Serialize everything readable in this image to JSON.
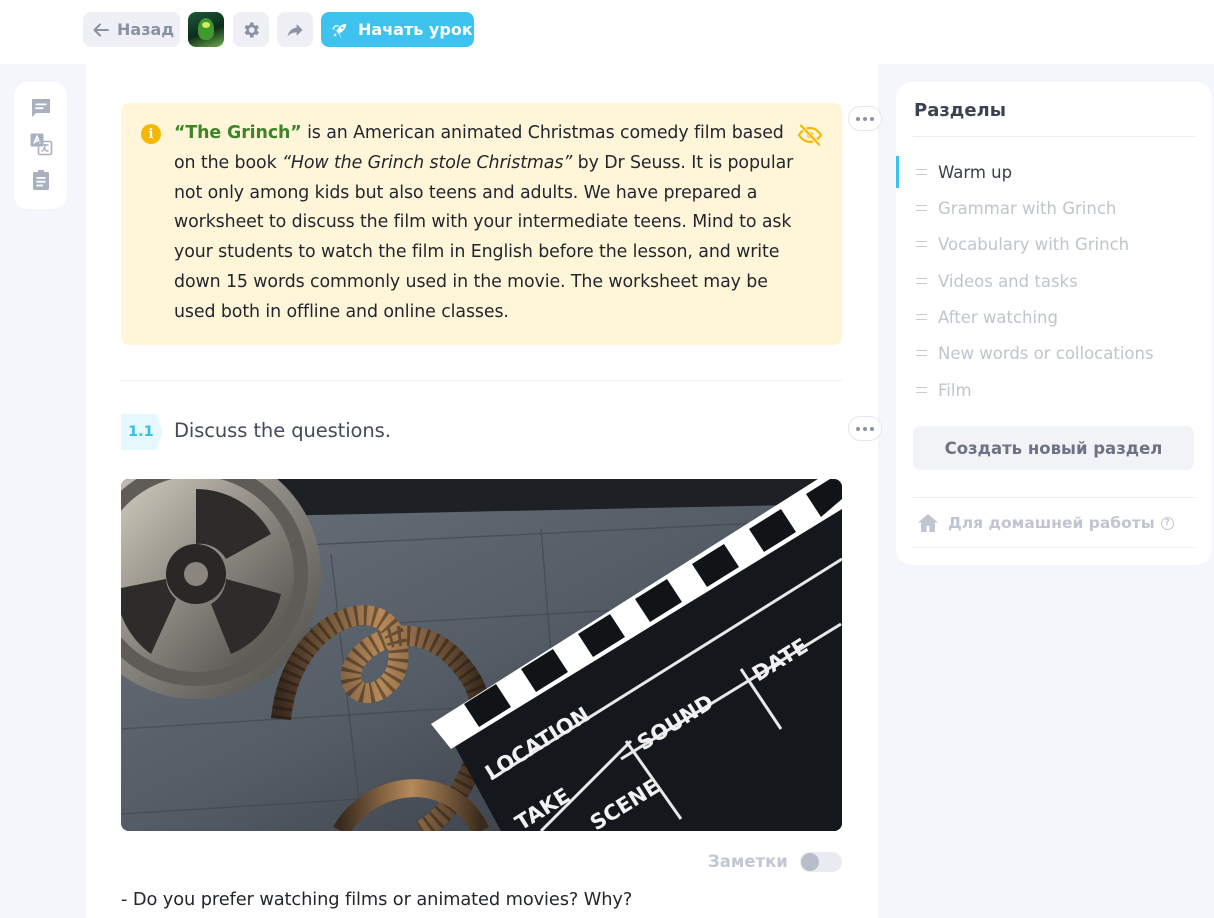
{
  "toolbar": {
    "back_label": "Назад",
    "start_label": "Начать урок",
    "accent_color": "#3ec3ee"
  },
  "tools": [
    "chat-icon",
    "translate-icon",
    "clipboard-icon"
  ],
  "info": {
    "highlight": "“The Grinch”",
    "text_1": " is an American animated Christmas comedy film based on the book ",
    "book_title": "“How the Grinch stole Christmas”",
    "text_2": " by Dr Seuss. It is popular not only among kids but also teens and adults. We have prepared a worksheet to discuss the film with your intermediate teens. Mind to ask your students to watch the film in English before the lesson, and write down 15 words commonly used in the movie. The worksheet may be used both in offline and online classes."
  },
  "exercise": {
    "number": "1.1",
    "title": "Discuss the questions."
  },
  "clapperboard": {
    "location": "LOCATION",
    "sound": "SOUND",
    "date": "DATE",
    "take": "TAKE",
    "scene": "SCENE"
  },
  "notes": {
    "label": "Заметки",
    "enabled": false
  },
  "question_1": "- Do you prefer watching films or animated movies? Why?",
  "sections": {
    "title": "Разделы",
    "items": [
      {
        "label": "Warm up",
        "active": true
      },
      {
        "label": "Grammar with Grinch",
        "active": false
      },
      {
        "label": "Vocabulary with Grinch",
        "active": false
      },
      {
        "label": "Videos and tasks",
        "active": false
      },
      {
        "label": "After watching",
        "active": false
      },
      {
        "label": "New words or collocations",
        "active": false
      },
      {
        "label": "Film",
        "active": false
      }
    ],
    "create_label": "Создать новый раздел",
    "homework_label": "Для домашней работы",
    "help_symbol": "?"
  }
}
